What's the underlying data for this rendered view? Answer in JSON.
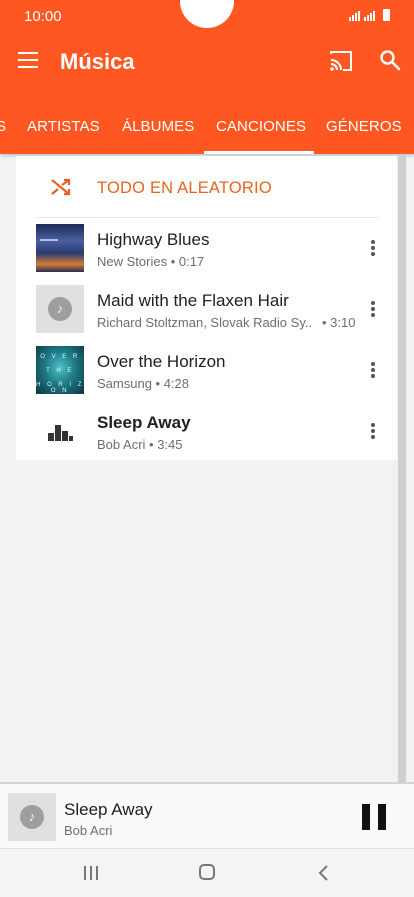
{
  "status_bar": {
    "time": "10:00"
  },
  "app_bar": {
    "title": "Música"
  },
  "tabs": [
    {
      "label": "ARTISTAS",
      "active": false
    },
    {
      "label": "ÁLBUMES",
      "active": false
    },
    {
      "label": "CANCIONES",
      "active": true
    },
    {
      "label": "GÉNEROS",
      "active": false
    }
  ],
  "tab_overflow_left": "S",
  "shuffle": {
    "label": "TODO EN ALEATORIO",
    "icon": "shuffle-icon"
  },
  "songs": [
    {
      "title": "Highway Blues",
      "subtitle": "New Stories • 0:17",
      "art": "album-art"
    },
    {
      "title": "Maid with the Flaxen Hair",
      "subtitle": "Richard Stoltzman, Slovak Radio Sy..",
      "duration": "• 3:10",
      "art": "default-music-art"
    },
    {
      "title": "Over the Horizon",
      "subtitle": "Samsung • 4:28",
      "art": "album-art",
      "art_text": [
        "O V E R",
        "T H E",
        "H O R I Z O N"
      ]
    },
    {
      "title": "Sleep Away",
      "subtitle": "Bob Acri • 3:45",
      "art": "now-playing-bars-icon",
      "playing": true
    }
  ],
  "player": {
    "title": "Sleep Away",
    "artist": "Bob Acri",
    "state": "playing"
  },
  "colors": {
    "accent": "#ff5722",
    "shuffle_text": "#e8621f"
  }
}
